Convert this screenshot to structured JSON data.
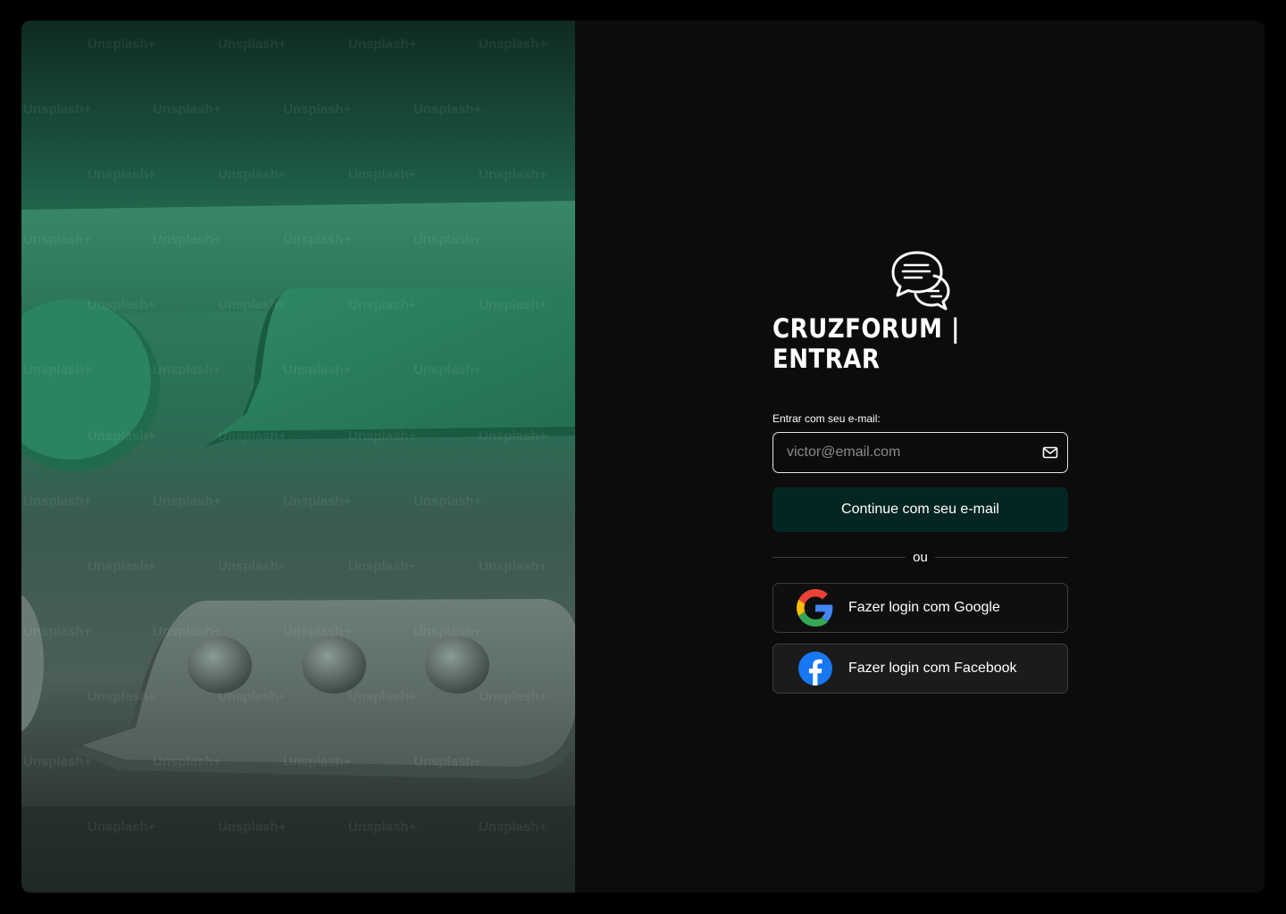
{
  "hero": {
    "watermark_text": "Unsplash+"
  },
  "brand": {
    "title": "CRUZFORUM | ENTRAR",
    "logo_icon": "chat-bubbles-icon"
  },
  "form": {
    "email_label": "Entrar com seu e-mail:",
    "email_placeholder": "victor@email.com",
    "email_value": "",
    "continue_label": "Continue com seu e-mail",
    "divider_label": "ou",
    "google_label": "Fazer login com Google",
    "facebook_label": "Fazer login com Facebook"
  },
  "colors": {
    "background": "#0d0c0b",
    "continue_button": "#042622",
    "facebook_blue": "#1877f2"
  }
}
